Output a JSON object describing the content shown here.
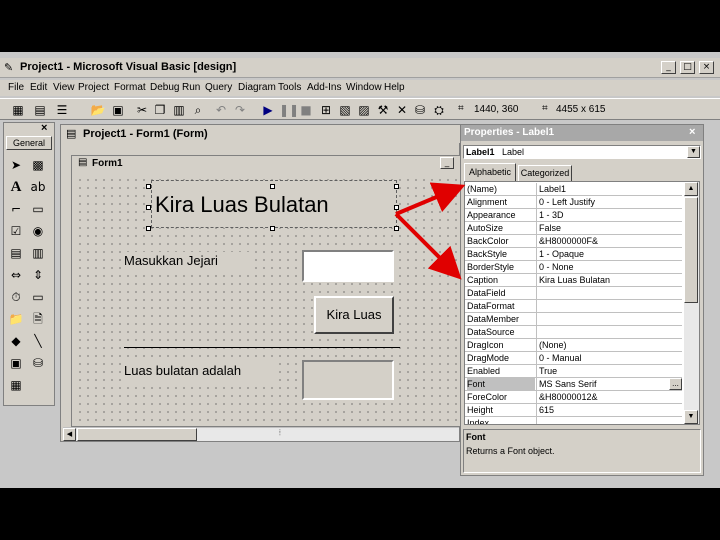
{
  "window": {
    "title": "Project1 - Microsoft Visual Basic [design]"
  },
  "menu": [
    "File",
    "Edit",
    "View",
    "Project",
    "Format",
    "Debug",
    "Run",
    "Query",
    "Diagram",
    "Tools",
    "Add-Ins",
    "Window",
    "Help"
  ],
  "toolbar": {
    "position": "1440, 360",
    "size": "4455 x 615"
  },
  "toolbox": {
    "title": "General"
  },
  "designer": {
    "title": "Project1 - Form1 (Form)",
    "form_caption": "Form1"
  },
  "form": {
    "label_title": "Kira Luas Bulatan",
    "label_radius": "Masukkan Jejari",
    "button": "Kira Luas",
    "label_result": "Luas bulatan adalah"
  },
  "properties": {
    "title": "Properties - Label1",
    "object": "Label1",
    "object_type": "Label",
    "tabs": [
      "Alphabetic",
      "Categorized"
    ],
    "rows": [
      {
        "name": "(Name)",
        "value": "Label1"
      },
      {
        "name": "Alignment",
        "value": "0 - Left Justify"
      },
      {
        "name": "Appearance",
        "value": "1 - 3D"
      },
      {
        "name": "AutoSize",
        "value": "False"
      },
      {
        "name": "BackColor",
        "value": "&H8000000F&"
      },
      {
        "name": "BackStyle",
        "value": "1 - Opaque"
      },
      {
        "name": "BorderStyle",
        "value": "0 - None"
      },
      {
        "name": "Caption",
        "value": "Kira Luas Bulatan"
      },
      {
        "name": "DataField",
        "value": ""
      },
      {
        "name": "DataFormat",
        "value": ""
      },
      {
        "name": "DataMember",
        "value": ""
      },
      {
        "name": "DataSource",
        "value": ""
      },
      {
        "name": "DragIcon",
        "value": "(None)"
      },
      {
        "name": "DragMode",
        "value": "0 - Manual"
      },
      {
        "name": "Enabled",
        "value": "True"
      },
      {
        "name": "Font",
        "value": "MS Sans Serif"
      },
      {
        "name": "ForeColor",
        "value": "&H80000012&"
      },
      {
        "name": "Height",
        "value": "615"
      },
      {
        "name": "Index",
        "value": ""
      }
    ],
    "selected_index": 15,
    "desc_title": "Font",
    "desc_text": "Returns a Font object."
  }
}
